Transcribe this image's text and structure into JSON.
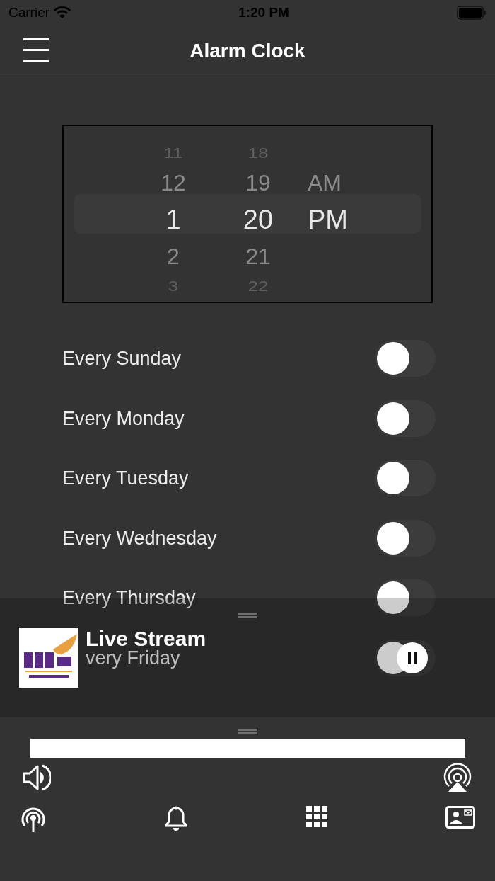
{
  "status_bar": {
    "carrier": "Carrier",
    "time": "1:20 PM"
  },
  "nav": {
    "title": "Alarm Clock"
  },
  "picker": {
    "columns": [
      {
        "items": [
          {
            "text": "11",
            "selected": false
          },
          {
            "text": "12",
            "selected": false
          },
          {
            "text": "1",
            "selected": true
          },
          {
            "text": "2",
            "selected": false
          },
          {
            "text": "3",
            "selected": false
          }
        ]
      },
      {
        "items": [
          {
            "text": "18",
            "selected": false
          },
          {
            "text": "19",
            "selected": false
          },
          {
            "text": "20",
            "selected": true
          },
          {
            "text": "21",
            "selected": false
          },
          {
            "text": "22",
            "selected": false
          }
        ]
      },
      {
        "items": [
          {
            "text": "AM",
            "selected": false
          },
          {
            "text": "PM",
            "selected": true
          }
        ]
      }
    ]
  },
  "days": [
    {
      "label": "Every Sunday",
      "on": false,
      "covered_left": false
    },
    {
      "label": "Every Monday",
      "on": false,
      "covered_left": false
    },
    {
      "label": "Every Tuesday",
      "on": false,
      "covered_left": false
    },
    {
      "label": "Every Wednesday",
      "on": false,
      "covered_left": false
    },
    {
      "label": "Every Thursday",
      "on": false,
      "covered_left": false
    },
    {
      "label": "very Friday",
      "on": false,
      "covered_left": true
    }
  ],
  "mini_player": {
    "title": "Live Stream",
    "playing": true
  },
  "progress": {
    "level": 1
  },
  "bottom_tabs": [
    {
      "kind": "broadcast"
    },
    {
      "kind": "alarm"
    },
    {
      "kind": "grid"
    },
    {
      "kind": "contact"
    }
  ]
}
